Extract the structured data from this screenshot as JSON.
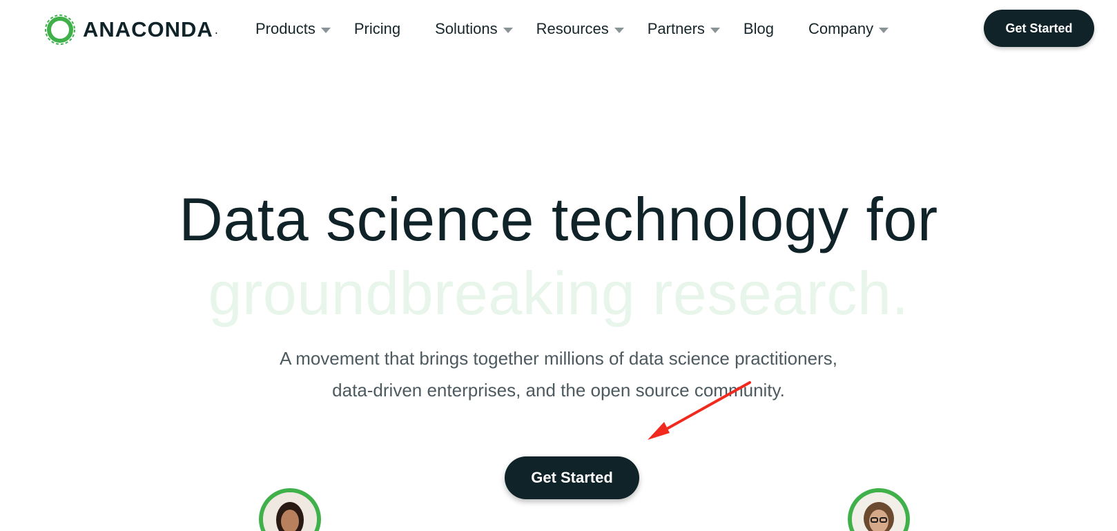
{
  "header": {
    "logo_text": "ANACONDA",
    "logo_suffix": ".",
    "nav": [
      {
        "label": "Products",
        "has_dropdown": true
      },
      {
        "label": "Pricing",
        "has_dropdown": false
      },
      {
        "label": "Solutions",
        "has_dropdown": true
      },
      {
        "label": "Resources",
        "has_dropdown": true
      },
      {
        "label": "Partners",
        "has_dropdown": true
      },
      {
        "label": "Blog",
        "has_dropdown": false
      },
      {
        "label": "Company",
        "has_dropdown": true
      }
    ],
    "cta_label": "Get Started"
  },
  "hero": {
    "headline_line1": "Data science technology for",
    "headline_line2": "groundbreaking research.",
    "subtitle_line1": "A movement that brings together millions of data science practitioners,",
    "subtitle_line2": "data-driven enterprises, and the open source community.",
    "cta_label": "Get Started"
  },
  "colors": {
    "brand_dark": "#0f2328",
    "brand_green": "#3fb04a",
    "headline_faded": "#e8f5ea",
    "subtitle": "#4d5a5f",
    "annotation_arrow": "#f02a1e"
  },
  "icons": {
    "logo": "anaconda-ring-icon",
    "dropdown": "caret-down-icon"
  }
}
